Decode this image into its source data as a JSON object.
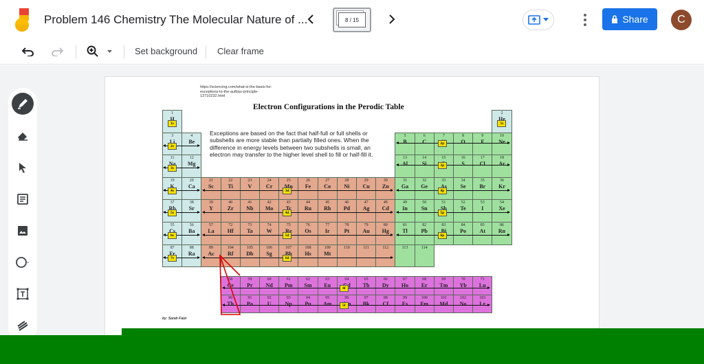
{
  "header": {
    "doc_title": "Problem 146 Chemistry The Molecular Nature of ...",
    "frame_counter": "8 / 15",
    "share_label": "Share",
    "avatar_initial": "C"
  },
  "toolbar": {
    "set_background_label": "Set background",
    "clear_frame_label": "Clear frame"
  },
  "left_tools": [
    "pen-icon",
    "eraser-icon",
    "select-icon",
    "sticky-note-icon",
    "image-icon",
    "circle-icon",
    "textbox-icon",
    "laser-icon"
  ],
  "slide": {
    "url": "https://sciencing.com/what-is-the-basis-for-exceptions-to-the-aufbau-principle-13710232.html",
    "title": "Electron Configurations in the Perodic Table",
    "note": "Exceptions are based on the fact that half-full or full shells or subshells are more stable than partially filled ones. When the difference in energy levels between two subshells is small, an electron may transfer to the higher level shell to fill or half-fill it.",
    "credit": "by: Sarah Faizi",
    "colors": {
      "s_block": "#cfe9e9",
      "d_block": "#e3a88e",
      "p_block": "#9fe09f",
      "f_block": "#dd72dd",
      "label": "#f5e100"
    },
    "elements": [
      [
        "1",
        "H"
      ],
      [
        "2",
        "He"
      ],
      [
        "3",
        "Li"
      ],
      [
        "4",
        "Be"
      ],
      [
        "5",
        "B"
      ],
      [
        "6",
        "C"
      ],
      [
        "7",
        "N"
      ],
      [
        "8",
        "O"
      ],
      [
        "9",
        "F"
      ],
      [
        "10",
        "Ne"
      ],
      [
        "11",
        "Na"
      ],
      [
        "12",
        "Mg"
      ],
      [
        "13",
        "Al"
      ],
      [
        "14",
        "Si"
      ],
      [
        "15",
        "P"
      ],
      [
        "16",
        "S"
      ],
      [
        "17",
        "Cl"
      ],
      [
        "18",
        "Ar"
      ],
      [
        "19",
        "K"
      ],
      [
        "20",
        "Ca"
      ],
      [
        "21",
        "Sc"
      ],
      [
        "22",
        "Ti"
      ],
      [
        "23",
        "V"
      ],
      [
        "24",
        "Cr"
      ],
      [
        "25",
        "Mn"
      ],
      [
        "26",
        "Fe"
      ],
      [
        "27",
        "Co"
      ],
      [
        "28",
        "Ni"
      ],
      [
        "29",
        "Cu"
      ],
      [
        "30",
        "Zn"
      ],
      [
        "31",
        "Ga"
      ],
      [
        "32",
        "Ge"
      ],
      [
        "33",
        "As"
      ],
      [
        "34",
        "Se"
      ],
      [
        "35",
        "Br"
      ],
      [
        "36",
        "Kr"
      ],
      [
        "37",
        "Rb"
      ],
      [
        "38",
        "Sr"
      ],
      [
        "39",
        "Y"
      ],
      [
        "40",
        "Zr"
      ],
      [
        "41",
        "Nb"
      ],
      [
        "42",
        "Mo"
      ],
      [
        "43",
        "Tc"
      ],
      [
        "44",
        "Ru"
      ],
      [
        "45",
        "Rh"
      ],
      [
        "46",
        "Pd"
      ],
      [
        "47",
        "Ag"
      ],
      [
        "48",
        "Cd"
      ],
      [
        "49",
        "In"
      ],
      [
        "50",
        "Sn"
      ],
      [
        "51",
        "Sb"
      ],
      [
        "52",
        "Te"
      ],
      [
        "53",
        "I"
      ],
      [
        "54",
        "Xe"
      ],
      [
        "55",
        "Cs"
      ],
      [
        "56",
        "Ba"
      ],
      [
        "57",
        "La"
      ],
      [
        "72",
        "Hf"
      ],
      [
        "73",
        "Ta"
      ],
      [
        "74",
        "W"
      ],
      [
        "75",
        "Re"
      ],
      [
        "76",
        "Os"
      ],
      [
        "77",
        "Ir"
      ],
      [
        "78",
        "Pt"
      ],
      [
        "79",
        "Au"
      ],
      [
        "80",
        "Hg"
      ],
      [
        "81",
        "Tl"
      ],
      [
        "82",
        "Pb"
      ],
      [
        "83",
        "Bi"
      ],
      [
        "84",
        "Po"
      ],
      [
        "85",
        "At"
      ],
      [
        "86",
        "Rn"
      ],
      [
        "87",
        "Fr"
      ],
      [
        "88",
        "Ra"
      ],
      [
        "89",
        "Ac"
      ],
      [
        "104",
        "Rf"
      ],
      [
        "105",
        "Db"
      ],
      [
        "106",
        "Sg"
      ],
      [
        "107",
        "Bh"
      ],
      [
        "108",
        "Hs"
      ],
      [
        "109",
        "Mt"
      ],
      [
        "110",
        ""
      ],
      [
        "111",
        ""
      ],
      [
        "112",
        ""
      ],
      [
        "113",
        ""
      ],
      [
        "114",
        ""
      ],
      [
        "58",
        "Ce"
      ],
      [
        "59",
        "Pr"
      ],
      [
        "60",
        "Nd"
      ],
      [
        "61",
        "Pm"
      ],
      [
        "62",
        "Sm"
      ],
      [
        "63",
        "Eu"
      ],
      [
        "64",
        "Gd"
      ],
      [
        "65",
        "Tb"
      ],
      [
        "66",
        "Dy"
      ],
      [
        "67",
        "Ho"
      ],
      [
        "68",
        "Er"
      ],
      [
        "69",
        "Tm"
      ],
      [
        "70",
        "Yb"
      ],
      [
        "71",
        "Lu"
      ],
      [
        "90",
        "Th"
      ],
      [
        "91",
        "Pa"
      ],
      [
        "92",
        "U"
      ],
      [
        "93",
        "Np"
      ],
      [
        "94",
        "Pu"
      ],
      [
        "95",
        "Am"
      ],
      [
        "96",
        "Cm"
      ],
      [
        "97",
        "Bk"
      ],
      [
        "98",
        "Cf"
      ],
      [
        "99",
        "Es"
      ],
      [
        "100",
        "Fm"
      ],
      [
        "101",
        "Md"
      ],
      [
        "102",
        "No"
      ],
      [
        "103",
        "Lr"
      ]
    ],
    "labels": [
      "1s",
      "1s",
      "2s",
      "2p",
      "3s",
      "3p",
      "4s",
      "3d",
      "4p",
      "5s",
      "4d",
      "5p",
      "6s",
      "5d",
      "6p",
      "7s",
      "6d",
      "4f",
      "5f"
    ]
  }
}
